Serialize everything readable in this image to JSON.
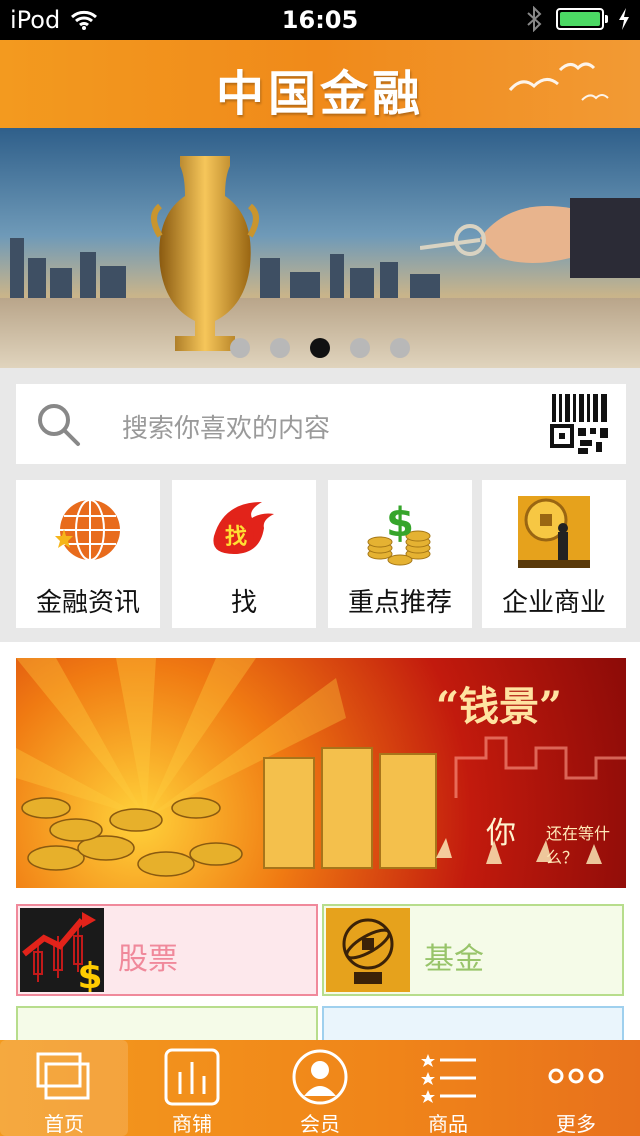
{
  "status_bar": {
    "carrier": "iPod",
    "time": "16:05",
    "battery_percent": 100
  },
  "header": {
    "title": "中国金融"
  },
  "banner": {
    "slide_count": 5,
    "active_index": 2
  },
  "search": {
    "placeholder": "搜索你喜欢的内容"
  },
  "quick_links": [
    {
      "label": "金融资讯",
      "icon": "globe-icon"
    },
    {
      "label": "找",
      "icon": "find-badge-icon"
    },
    {
      "label": "重点推荐",
      "icon": "money-coins-icon"
    },
    {
      "label": "企业商业",
      "icon": "coin-business-icon"
    }
  ],
  "promo": {
    "title": "“钱景”",
    "line1": "你",
    "line2": "还在等什么？"
  },
  "categories": [
    {
      "label": "股票",
      "color": "#f0899b",
      "bg": "#fde8ec",
      "icon": "stock-chart-icon"
    },
    {
      "label": "基金",
      "color": "#b7dd8c",
      "bg": "#f5fbe8",
      "icon": "armillary-sphere-icon"
    }
  ],
  "tabs": [
    {
      "label": "首页",
      "icon": "home-windows-icon",
      "active": true
    },
    {
      "label": "商铺",
      "icon": "shop-bars-icon",
      "active": false
    },
    {
      "label": "会员",
      "icon": "member-avatar-icon",
      "active": false
    },
    {
      "label": "商品",
      "icon": "goods-list-icon",
      "active": false
    },
    {
      "label": "更多",
      "icon": "more-dots-icon",
      "active": false
    }
  ],
  "colors": {
    "header_orange": "#f39a1f",
    "tab_orange": "#f08519",
    "stock_pink": "#f0899b",
    "fund_green": "#b7dd8c",
    "fund_blue_edge": "#9fd0ee"
  }
}
